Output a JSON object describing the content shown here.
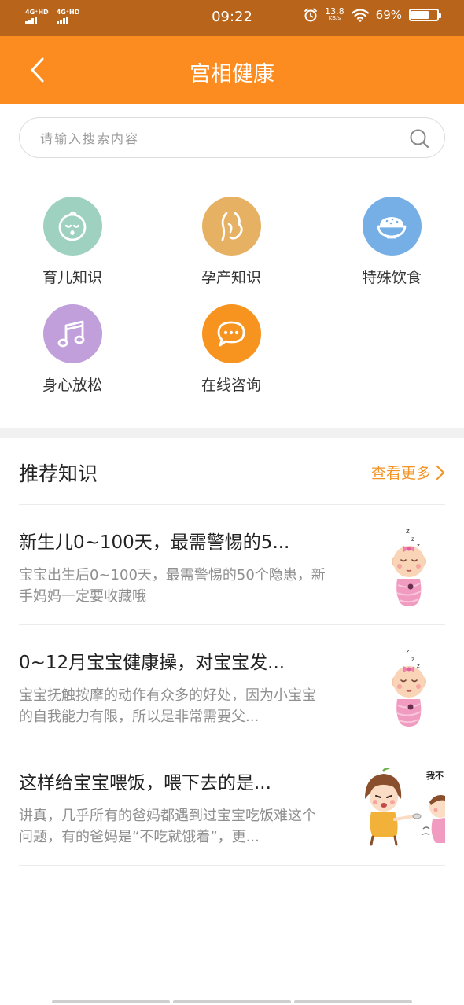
{
  "status_bar": {
    "signal1": "4G⁺HD",
    "signal2": "4G⁺HD",
    "time": "09:22",
    "net_speed_value": "13.8",
    "net_speed_unit": "KB/s",
    "battery_text": "69%",
    "battery_level": 0.69
  },
  "header": {
    "title": "宫相健康",
    "back_icon": "chevron-left-icon"
  },
  "search": {
    "placeholder": "请输入搜索内容",
    "value": "",
    "icon": "search-icon"
  },
  "categories": [
    {
      "label": "育儿知识",
      "icon": "baby-face-icon",
      "color": "#9ed1bf"
    },
    {
      "label": "孕产知识",
      "icon": "pregnancy-icon",
      "color": "#e6b162"
    },
    {
      "label": "特殊饮食",
      "icon": "rice-bowl-icon",
      "color": "#76aee6"
    },
    {
      "label": "身心放松",
      "icon": "music-note-icon",
      "color": "#c19fdb"
    },
    {
      "label": "在线咨询",
      "icon": "chat-bubble-icon",
      "color": "#f7931f"
    }
  ],
  "recommend": {
    "title": "推荐知识",
    "more_label": "查看更多",
    "accent_color": "#f39426",
    "articles": [
      {
        "title": "新生儿0~100天，最需警惕的5...",
        "desc": "宝宝出生后0~100天，最需警惕的50个隐患，新手妈妈一定要收藏哦",
        "thumb": "sleeping-baby-illustration"
      },
      {
        "title": "0~12月宝宝健康操，对宝宝发...",
        "desc": "宝宝抚触按摩的动作有众多的好处，因为小宝宝的自我能力有限，所以是非常需要父...",
        "thumb": "sleeping-baby-illustration"
      },
      {
        "title": "这样给宝宝喂饭，喂下去的是...",
        "desc": "讲真，几乎所有的爸妈都遇到过宝宝吃饭难这个问题，有的爸妈是“不吃就饿着”，更...",
        "thumb": "feeding-cartoon-illustration",
        "thumb_text": "我不"
      }
    ]
  },
  "colors": {
    "status_bar": "#b8641a",
    "title_bar": "#fd8c20"
  }
}
